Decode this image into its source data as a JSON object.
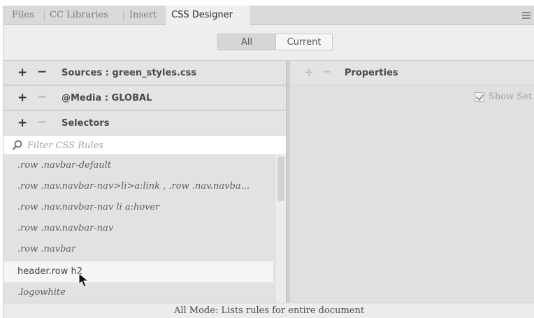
{
  "tabs": [
    {
      "label": "Files"
    },
    {
      "label": "CC Libraries"
    },
    {
      "label": "Insert"
    },
    {
      "label": "CSS Designer",
      "active": true
    }
  ],
  "mode": {
    "all_label": "All",
    "current_label": "Current",
    "selected": "All"
  },
  "sources": {
    "title": "Sources : green_styles.css"
  },
  "media": {
    "title": "@Media : GLOBAL"
  },
  "selectors": {
    "title": "Selectors",
    "filter_placeholder": "Filter CSS Rules",
    "items": [
      {
        "label": ".row .navbar-default"
      },
      {
        "label": ".row .nav.navbar-nav>li>a:link , .row .nav.navba..."
      },
      {
        "label": ".row .nav.navbar-nav li a:hover"
      },
      {
        "label": ".row .nav.navbar-nav"
      },
      {
        "label": ".row .navbar"
      },
      {
        "label": "header.row h2",
        "selected": true
      },
      {
        "label": ".logowhite"
      }
    ]
  },
  "properties": {
    "title": "Properties",
    "show_set_label": "Show Set",
    "show_set_checked": true
  },
  "status": {
    "text": "All Mode: Lists rules for entire document"
  },
  "icons": {
    "menu": "panel-menu-icon",
    "filter": "search-icon",
    "cursor": "mouse-cursor-icon"
  }
}
